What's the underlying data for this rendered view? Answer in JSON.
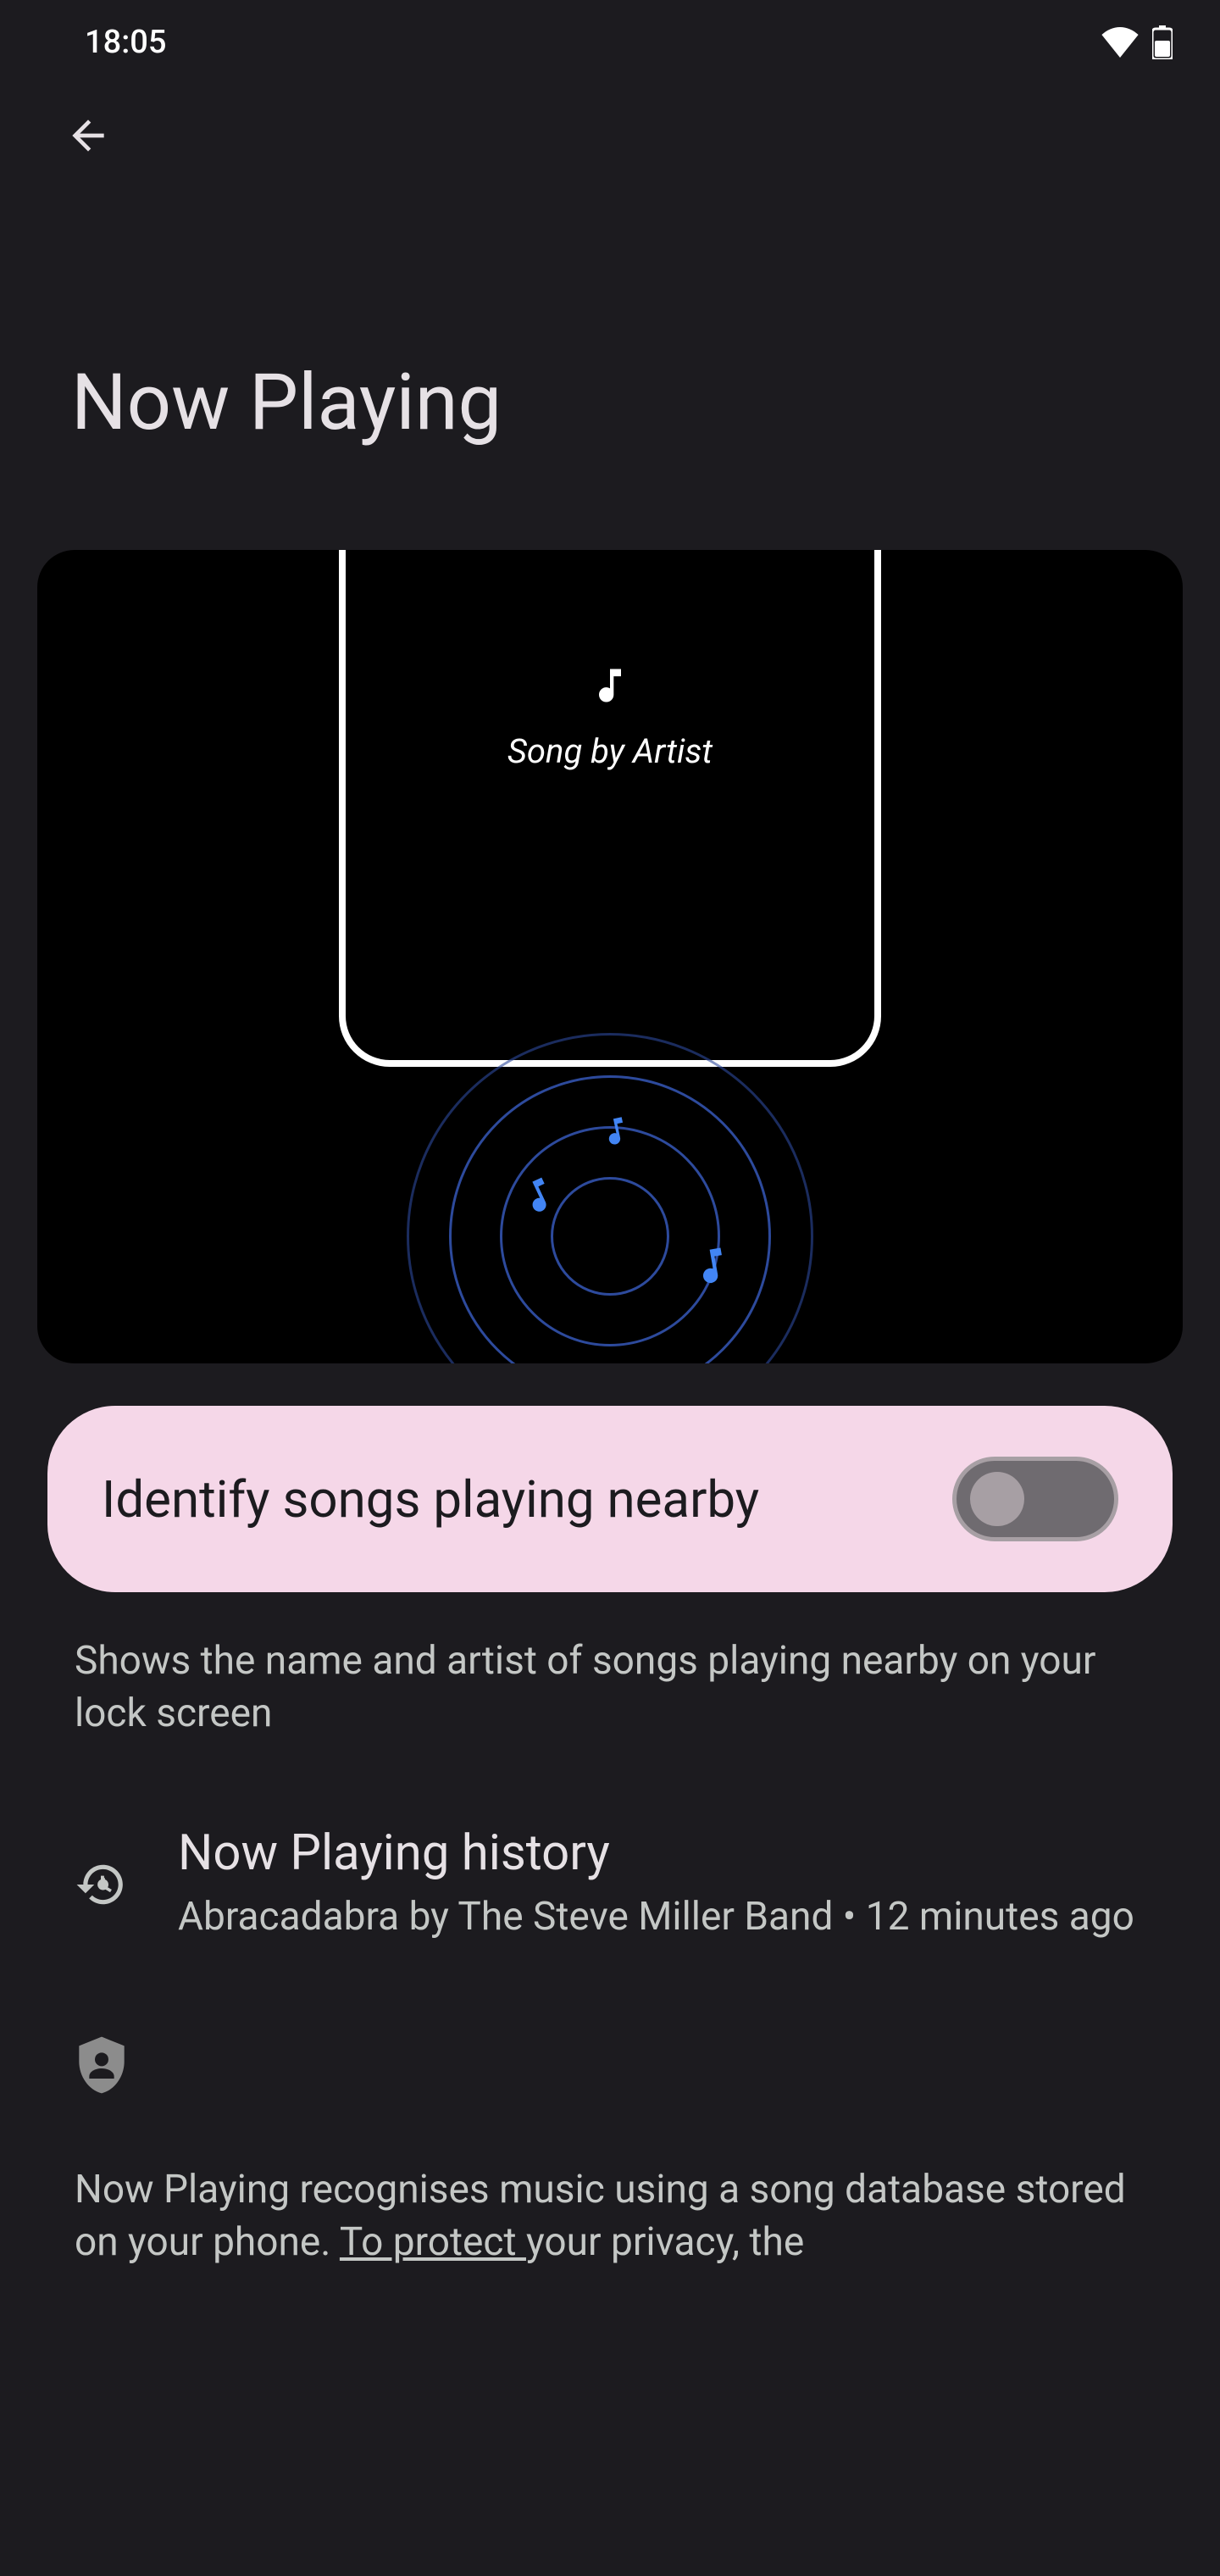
{
  "status_bar": {
    "time": "18:05"
  },
  "page": {
    "title": "Now Playing"
  },
  "hero": {
    "song_label": "Song by Artist"
  },
  "toggle": {
    "label": "Identify songs playing nearby",
    "enabled": false
  },
  "description": "Shows the name and artist of songs playing nearby on your lock screen",
  "history": {
    "title": "Now Playing history",
    "subtitle": "Abracadabra by The Steve Miller Band • 12 minutes ago"
  },
  "privacy": {
    "text_before": "Now Playing recognises music using a song database stored on your phone. ",
    "link": "To protect ",
    "text_after": "your privacy, the"
  }
}
